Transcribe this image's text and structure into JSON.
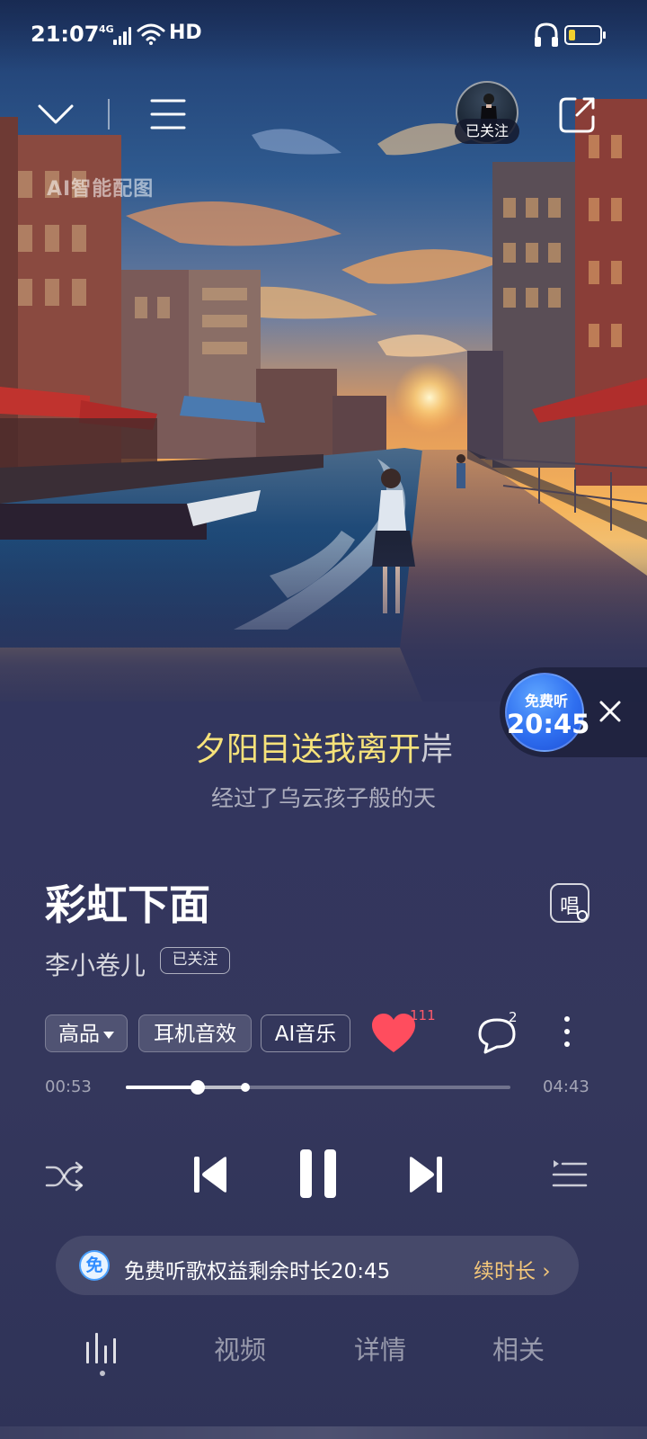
{
  "status_bar": {
    "time": "21:07",
    "network": "4G",
    "hd": "HD",
    "battery_level": 0.2,
    "battery_color": "#f2d02e"
  },
  "top_nav": {
    "collapse_icon": "chevron-down-icon",
    "menu_icon": "menu-icon",
    "share_icon": "share-icon",
    "artist_follow_label": "已关注"
  },
  "artwork": {
    "ai_tag": "AI智能配图"
  },
  "free_badge": {
    "label": "免费听",
    "time": "20:45",
    "close_icon": "close-icon"
  },
  "lyrics": {
    "current_sung": "夕阳目送我离开",
    "current_rest": "岸",
    "next": "经过了乌云孩子般的天"
  },
  "song": {
    "title": "彩虹下面",
    "artist": "李小卷儿",
    "artist_follow": "已关注",
    "sing_label": "唱"
  },
  "actions": {
    "quality": "高品",
    "earphone_effect": "耳机音效",
    "ai_music": "AI音乐",
    "likes": "111",
    "comments": "2",
    "like_color": "#ff4d5e"
  },
  "progress": {
    "elapsed": "00:53",
    "total": "04:43",
    "played_fraction": 0.187,
    "buffered_fraction": 0.31
  },
  "controls": {
    "shuffle_icon": "shuffle-icon",
    "prev_icon": "previous-icon",
    "pause_icon": "pause-icon",
    "next_icon": "next-icon",
    "playlist_icon": "playlist-icon"
  },
  "free_banner": {
    "icon_text": "免",
    "text": "免费听歌权益剩余时长20:45",
    "link": "续时长"
  },
  "tabs": {
    "video": "视频",
    "detail": "详情",
    "related": "相关"
  }
}
